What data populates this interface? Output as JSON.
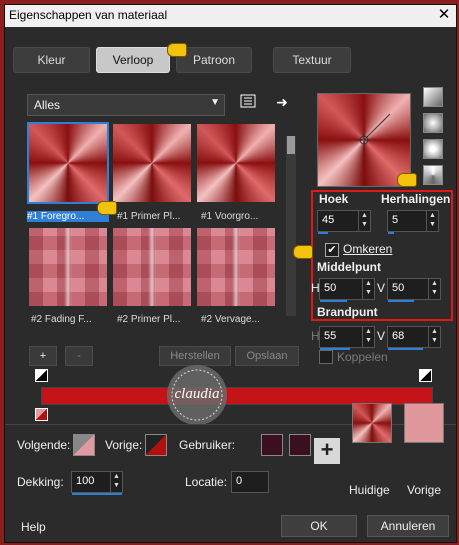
{
  "window": {
    "title": "Eigenschappen van materiaal",
    "close": "✕"
  },
  "tabs": [
    {
      "label": "Kleur"
    },
    {
      "label": "Verloop"
    },
    {
      "label": "Patroon"
    },
    {
      "label": "Textuur"
    }
  ],
  "library": {
    "dropdown_value": "Alles",
    "items": [
      {
        "label": "#1 Foregro..."
      },
      {
        "label": "#1 Primer Pl..."
      },
      {
        "label": "#1 Voorgro..."
      },
      {
        "label": "#2 Fading F..."
      },
      {
        "label": "#2 Primer Pl..."
      },
      {
        "label": "#2 Vervage..."
      }
    ],
    "add": "+",
    "remove": "-",
    "restore": "Herstellen",
    "save": "Opslaan"
  },
  "settings": {
    "hoek_label": "Hoek",
    "hoek_value": "45",
    "herhalingen_label": "Herhalingen",
    "herhalingen_value": "5",
    "omkeren_label": "Omkeren",
    "middelpunt_label": "Middelpunt",
    "h_label": "H",
    "v_label": "V",
    "middel_h": "50",
    "middel_v": "50",
    "brandpunt_label": "Brandpunt",
    "brand_h": "55",
    "brand_v": "68",
    "koppelen_label": "Koppelen"
  },
  "bottom": {
    "volgende_label": "Volgende:",
    "vorige_label": "Vorige:",
    "gebruiker_label": "Gebruiker:",
    "dekking_label": "Dekking:",
    "dekking_value": "100",
    "locatie_label": "Locatie:",
    "locatie_value": "0",
    "huidige_label": "Huidige",
    "vorige_swatch_label": "Vorige",
    "help": "Help",
    "ok": "OK",
    "cancel": "Annuleren"
  },
  "watermark": {
    "text": "claudia"
  },
  "colors": {
    "accent": "#2f7fd8",
    "highlight": "#e01818",
    "gradient_red": "#c4141a",
    "pink": "#e0989c",
    "dark_user": "#3a1020"
  }
}
